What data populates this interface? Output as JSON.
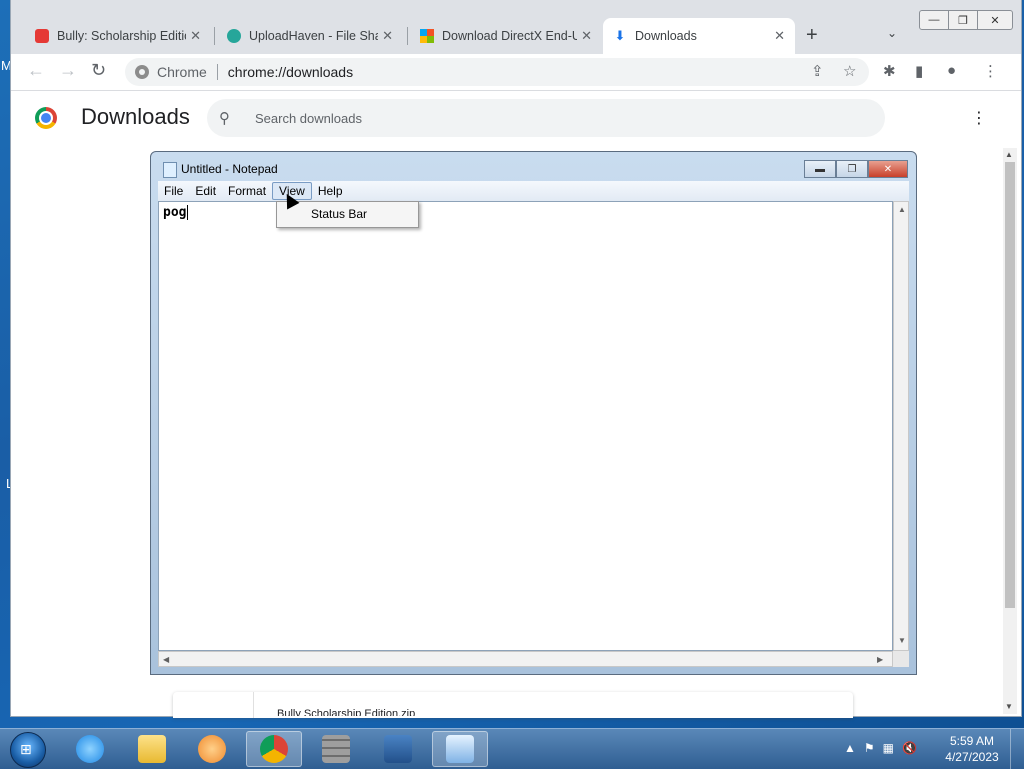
{
  "desktop": {
    "letter_m": "M",
    "letter_l": "L"
  },
  "browser": {
    "tabs": [
      {
        "title": "Bully: Scholarship Edition",
        "close": "✕",
        "color": "#e53935"
      },
      {
        "title": "UploadHaven - File Sharing",
        "close": "✕",
        "color": "#26a69a"
      },
      {
        "title": "Download DirectX End-User",
        "close": "✕",
        "color": "#4caf50"
      },
      {
        "title": "Downloads",
        "close": "✕",
        "color": "#1a73e8"
      }
    ],
    "new_tab": "+",
    "tab_search": "⌄",
    "window_buttons": {
      "minimize": "—",
      "maximize": "❐",
      "close": "✕"
    },
    "nav": {
      "back": "←",
      "forward": "→",
      "reload": "↻"
    },
    "omnibox": {
      "site_label": "Chrome",
      "url": "chrome://downloads"
    },
    "toolbar_icons": {
      "share": "⇪",
      "bookmark": "☆",
      "extensions": "✱",
      "side_panel": "▮",
      "profile": "●",
      "menu": "⋮"
    }
  },
  "downloads": {
    "title": "Downloads",
    "search_placeholder": "Search downloads",
    "search_icon": "🔍",
    "menu": "⋮",
    "partial_item_text": "Bully Scholarship Edition.zip"
  },
  "notepad": {
    "title": "Untitled - Notepad",
    "controls": {
      "minimize": "▬",
      "maximize": "❐",
      "close": "✕"
    },
    "menu": [
      "File",
      "Edit",
      "Format",
      "View",
      "Help"
    ],
    "open_menu": "View",
    "content": "pog",
    "dropdown_items": [
      "Status Bar"
    ],
    "scroll": {
      "up": "▲",
      "down": "▼",
      "left": "◀",
      "right": "▶"
    }
  },
  "taskbar": {
    "start": "⊞",
    "apps": [
      {
        "name": "Internet Explorer",
        "color": "#1e88e5"
      },
      {
        "name": "Windows Explorer",
        "color": "#f4c542"
      },
      {
        "name": "Windows Media Player",
        "color": "#ef8a2e"
      },
      {
        "name": "Google Chrome",
        "color": "#4caf50",
        "active": true
      },
      {
        "name": "Firewall",
        "color": "#8d8d8d"
      },
      {
        "name": "Computer",
        "color": "#3a6ea5"
      },
      {
        "name": "Notepad",
        "color": "#7fb2e5",
        "active": true
      }
    ],
    "tray_icons": {
      "show_hidden": "▲",
      "flag": "⚑",
      "network": "▦",
      "volume": "🔇"
    },
    "time": "5:59 AM",
    "date": "4/27/2023"
  },
  "colors": {
    "chrome_tabstrip": "#dee1e6",
    "accent": "#1a73e8",
    "taskbar": "#2f5e92"
  }
}
